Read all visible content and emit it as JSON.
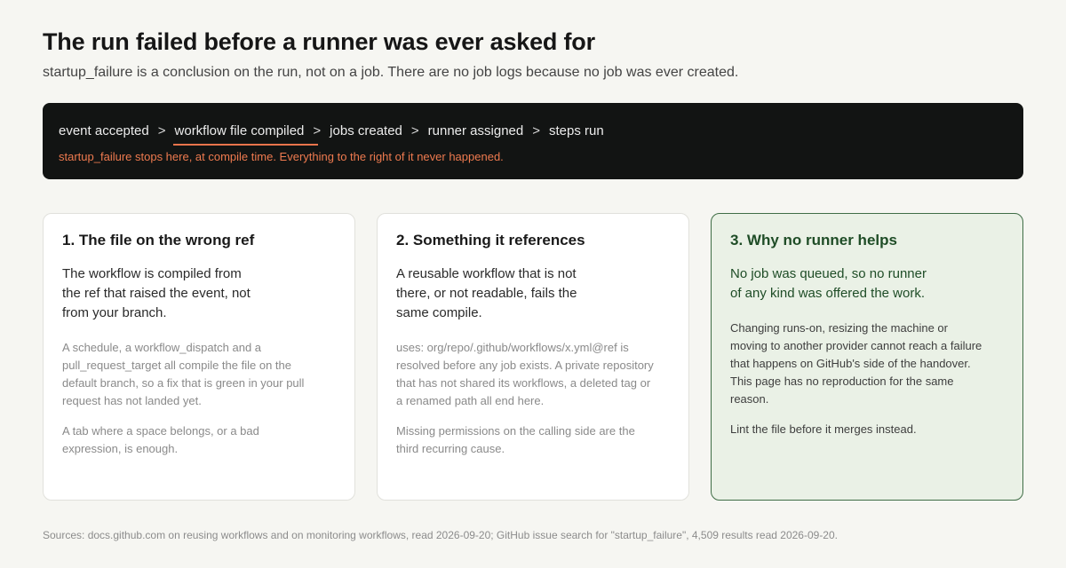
{
  "header": {
    "title": "The run failed before a runner was ever asked for",
    "subtitle": "startup_failure is a conclusion on the run, not on a job. There are no job logs because no job was ever created."
  },
  "pipeline": {
    "stages": [
      "event accepted",
      "workflow file compiled",
      "jobs created",
      "runner assigned",
      "steps run"
    ],
    "separator": ">",
    "active_stage": "workflow file compiled",
    "note": "startup_failure stops here, at compile time. Everything to the right of it never happened.",
    "accent_color": "#e8744c"
  },
  "cards": [
    {
      "title": "1. The file on the wrong ref",
      "lead": "The workflow is compiled from the ref that raised the event, not from your branch.",
      "body": [
        "A schedule, a workflow_dispatch and a pull_request_target all compile the file on the default branch, so a fix that is green in your pull request has not landed yet.",
        "A tab where a space belongs, or a bad expression, is enough."
      ]
    },
    {
      "title": "2. Something it references",
      "lead": "A reusable workflow that is not there, or not readable, fails the same compile.",
      "body": [
        "uses: org/repo/.github/workflows/x.yml@ref is resolved before any job exists. A private repository that has not shared its workflows, a deleted tag or a renamed path all end here.",
        "Missing permissions on the calling side are the third recurring cause."
      ]
    },
    {
      "title": "3. Why no runner helps",
      "lead": "No job was queued, so no runner of any kind was offered the work.",
      "body": [
        "Changing runs-on, resizing the machine or moving to another provider cannot reach a failure that happens on GitHub's side of the handover. This page has no reproduction for the same reason.",
        "Lint the file before it merges instead."
      ],
      "highlight_color": "#3f6d46"
    }
  ],
  "footer": {
    "sources": "Sources: docs.github.com on reusing workflows and on monitoring workflows, read 2026-09-20; GitHub issue search for \"startup_failure\", 4,509 results read 2026-09-20."
  }
}
